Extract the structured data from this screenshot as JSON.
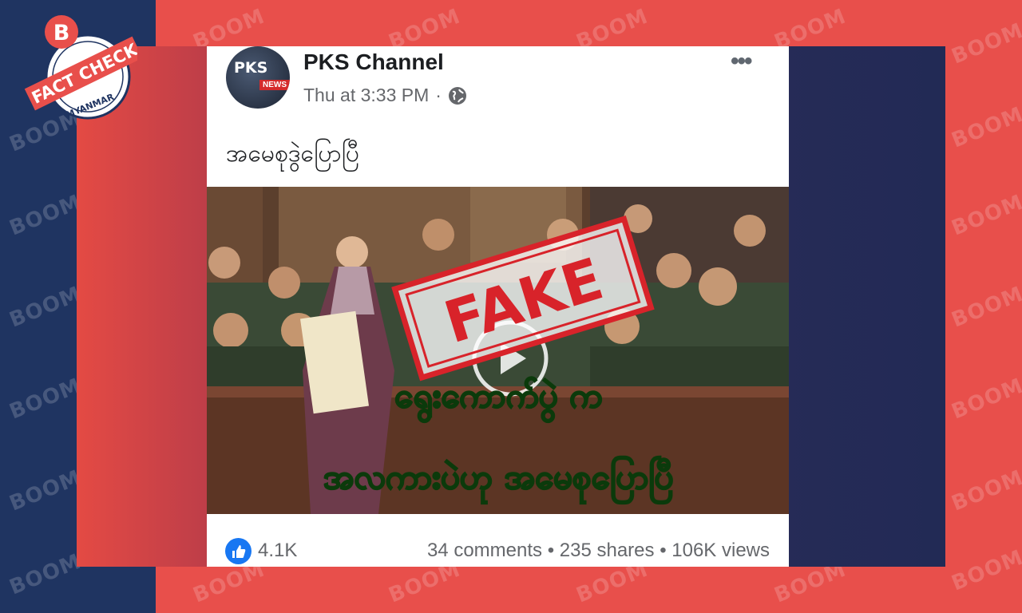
{
  "watermark": {
    "text": "BOOM"
  },
  "logo": {
    "letter": "B",
    "banner": "FACT CHECK",
    "subtitle": "MYANMAR"
  },
  "post": {
    "page_name": "PKS Channel",
    "avatar": {
      "top": "PKS",
      "badge": "NEWS"
    },
    "timestamp": "Thu at 3:33 PM",
    "separator": "·",
    "more_label": "•••",
    "caption": "အမေစုဒွဲပြောပြီ"
  },
  "video": {
    "stamp": "FAKE",
    "overlay_line1": "ရွေးကောက်ပွဲ က",
    "overlay_line2": "အလကားပဲဟု အမေစုပြောပြီ"
  },
  "footer": {
    "likes": "4.1K",
    "comments": "34 comments",
    "shares": "235 shares",
    "views": "106K views",
    "dot": "•"
  },
  "colors": {
    "navy": "#1f3461",
    "red": "#e84f4b",
    "facebook_blue": "#1877f2",
    "stamp_red": "#d8232a",
    "overlay_green": "#7dff5a"
  }
}
